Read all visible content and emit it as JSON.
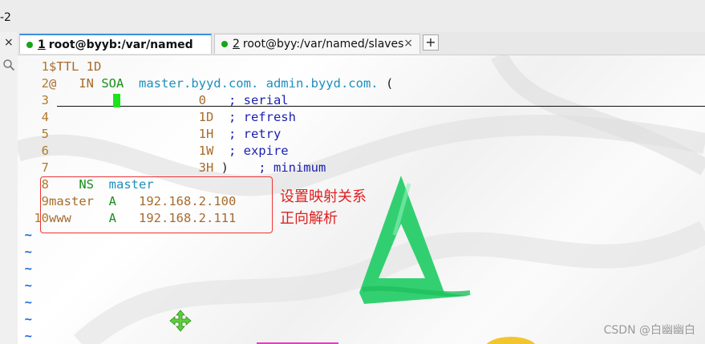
{
  "window": {
    "title": "-2"
  },
  "left_strip": {
    "close_label": "×",
    "search_icon": "search-icon"
  },
  "tabs": [
    {
      "number": "1",
      "label": "root@byyb:/var/named",
      "active": true,
      "status_color": "#18a418"
    },
    {
      "number": "2",
      "label": "root@byy:/var/named/slaves",
      "active": false,
      "status_color": "#18a418",
      "close_label": "×"
    }
  ],
  "new_tab_label": "+",
  "editor": {
    "lines": [
      {
        "num": "1",
        "segments": [
          {
            "t": "$TTL 1D",
            "c": "#a76b2c"
          }
        ]
      },
      {
        "num": "2",
        "segments": [
          {
            "t": "@   ",
            "c": "#a76b2c"
          },
          {
            "t": "IN",
            "c": "#a76b2c"
          },
          {
            "t": " SOA",
            "c": "#1a8f1a"
          },
          {
            "t": "  master.byyd.com. admin.byyd.com.",
            "c": "#1e8fbf"
          },
          {
            "t": " (",
            "c": "#222222"
          }
        ]
      },
      {
        "num": "3",
        "segments": [
          {
            "t": "                    0",
            "c": "#a76b2c"
          },
          {
            "t": "   ; serial",
            "c": "#1a1fb0"
          }
        ]
      },
      {
        "num": "4",
        "segments": [
          {
            "t": "                    1D",
            "c": "#a76b2c"
          },
          {
            "t": "  ; refresh",
            "c": "#1a1fb0"
          }
        ]
      },
      {
        "num": "5",
        "segments": [
          {
            "t": "                    1H",
            "c": "#a76b2c"
          },
          {
            "t": "  ; retry",
            "c": "#1a1fb0"
          }
        ]
      },
      {
        "num": "6",
        "segments": [
          {
            "t": "                    1W",
            "c": "#a76b2c"
          },
          {
            "t": "  ; expire",
            "c": "#1a1fb0"
          }
        ]
      },
      {
        "num": "7",
        "segments": [
          {
            "t": "                    3H",
            "c": "#a76b2c"
          },
          {
            "t": " )",
            "c": "#222222"
          },
          {
            "t": "    ; minimum",
            "c": "#1a1fb0"
          }
        ]
      },
      {
        "num": "8",
        "segments": [
          {
            "t": "    NS",
            "c": "#1a8f1a"
          },
          {
            "t": "  master",
            "c": "#1e8fbf"
          }
        ]
      },
      {
        "num": "9",
        "segments": [
          {
            "t": "master",
            "c": "#a76b2c"
          },
          {
            "t": "  A",
            "c": "#1a8f1a"
          },
          {
            "t": "   192.168.2.100",
            "c": "#a76b2c"
          }
        ]
      },
      {
        "num": "10",
        "segments": [
          {
            "t": "www",
            "c": "#a76b2c"
          },
          {
            "t": "     A",
            "c": "#1a8f1a"
          },
          {
            "t": "   192.168.2.111",
            "c": "#a76b2c"
          }
        ]
      }
    ],
    "tilde": "~",
    "tilde_count": 7
  },
  "annotation": {
    "line1": "设置映射关系",
    "line2": "正向解析",
    "color": "#e02020"
  },
  "watermark": "CSDN @白幽幽白",
  "colors": {
    "accent_tab": "#3c8fe0",
    "cursor": "#19e519",
    "art_green": "#22cc66"
  }
}
